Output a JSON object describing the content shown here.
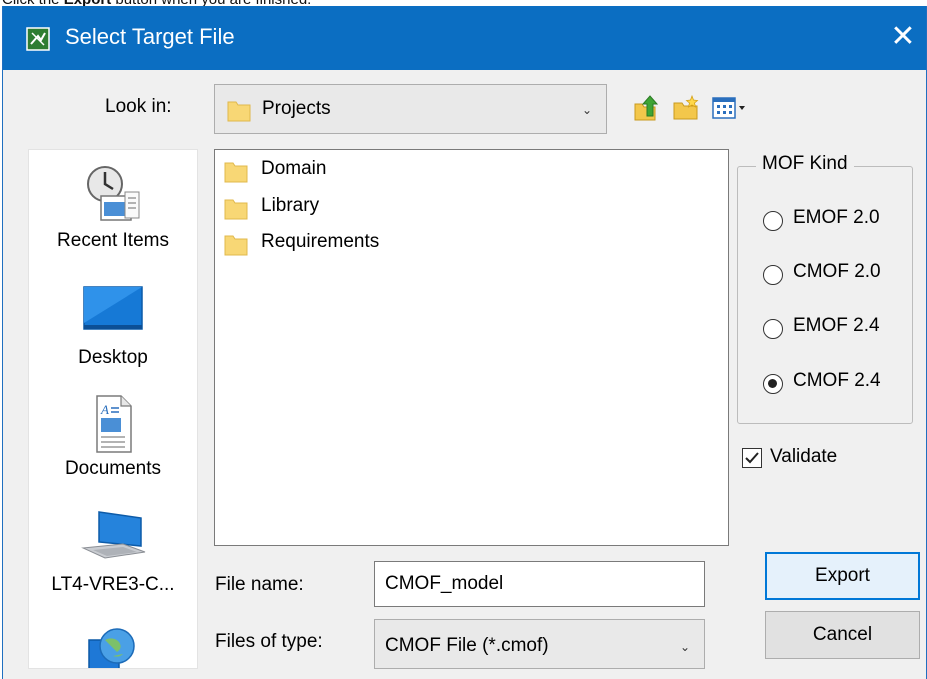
{
  "caption": {
    "pre": "Click the ",
    "bold": "Export",
    "post": " button when you are finished."
  },
  "dialog": {
    "title": "Select Target File",
    "close_glyph": "✕",
    "accent_color": "#0b6ec2"
  },
  "look_in": {
    "label": "Look in:",
    "value": "Projects",
    "icons": [
      "up-one-level-icon",
      "create-new-folder-icon",
      "view-menu-icon"
    ]
  },
  "places": [
    {
      "label": "Recent Items",
      "icon": "recent-items-icon"
    },
    {
      "label": "Desktop",
      "icon": "desktop-icon"
    },
    {
      "label": "Documents",
      "icon": "documents-icon"
    },
    {
      "label": "LT4-VRE3-C...",
      "icon": "computer-icon"
    },
    {
      "label": "",
      "icon": "network-icon"
    }
  ],
  "files": [
    {
      "name": "Domain",
      "icon": "folder-icon"
    },
    {
      "name": "Library",
      "icon": "folder-icon"
    },
    {
      "name": "Requirements",
      "icon": "folder-icon"
    }
  ],
  "mof_kind": {
    "legend": "MOF Kind",
    "options": [
      "EMOF 2.0",
      "CMOF 2.0",
      "EMOF 2.4",
      "CMOF 2.4"
    ],
    "selected": "CMOF 2.4"
  },
  "validate": {
    "label": "Validate",
    "checked": true
  },
  "file_name": {
    "label": "File name:",
    "value": "CMOF_model"
  },
  "files_of_type": {
    "label": "Files of type:",
    "value": "CMOF File (*.cmof)"
  },
  "buttons": {
    "export": "Export",
    "cancel": "Cancel"
  }
}
